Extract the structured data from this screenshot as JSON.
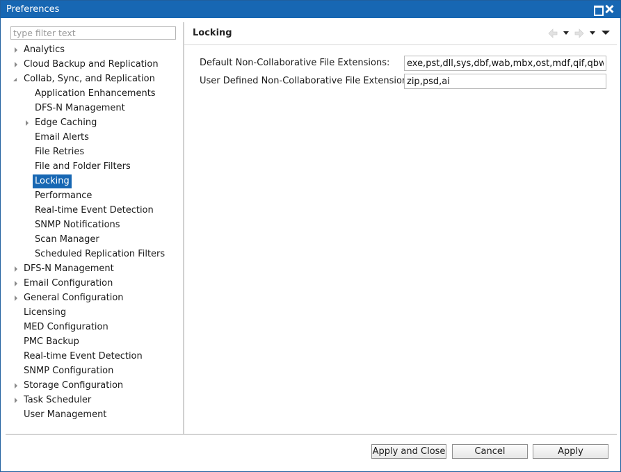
{
  "window": {
    "title": "Preferences"
  },
  "filter": {
    "placeholder": "type filter text",
    "value": ""
  },
  "tree": [
    {
      "label": "Analytics",
      "expander": "collapsed",
      "level": 0
    },
    {
      "label": "Cloud Backup and Replication",
      "expander": "collapsed",
      "level": 0
    },
    {
      "label": "Collab, Sync, and Replication",
      "expander": "expanded",
      "level": 0
    },
    {
      "label": "Application Enhancements",
      "expander": "none",
      "level": 1
    },
    {
      "label": "DFS-N Management",
      "expander": "none",
      "level": 1
    },
    {
      "label": "Edge Caching",
      "expander": "collapsed",
      "level": 1
    },
    {
      "label": "Email Alerts",
      "expander": "none",
      "level": 1
    },
    {
      "label": "File Retries",
      "expander": "none",
      "level": 1
    },
    {
      "label": "File and Folder Filters",
      "expander": "none",
      "level": 1
    },
    {
      "label": "Locking",
      "expander": "none",
      "level": 1,
      "selected": true
    },
    {
      "label": "Performance",
      "expander": "none",
      "level": 1
    },
    {
      "label": "Real-time Event Detection",
      "expander": "none",
      "level": 1
    },
    {
      "label": "SNMP Notifications",
      "expander": "none",
      "level": 1
    },
    {
      "label": "Scan Manager",
      "expander": "none",
      "level": 1
    },
    {
      "label": "Scheduled Replication Filters",
      "expander": "none",
      "level": 1
    },
    {
      "label": "DFS-N Management",
      "expander": "collapsed",
      "level": 0
    },
    {
      "label": "Email Configuration",
      "expander": "collapsed",
      "level": 0
    },
    {
      "label": "General Configuration",
      "expander": "collapsed",
      "level": 0
    },
    {
      "label": "Licensing",
      "expander": "none",
      "level": 0
    },
    {
      "label": "MED Configuration",
      "expander": "none",
      "level": 0
    },
    {
      "label": "PMC Backup",
      "expander": "none",
      "level": 0
    },
    {
      "label": "Real-time Event Detection",
      "expander": "none",
      "level": 0
    },
    {
      "label": "SNMP Configuration",
      "expander": "none",
      "level": 0
    },
    {
      "label": "Storage Configuration",
      "expander": "collapsed",
      "level": 0
    },
    {
      "label": "Task Scheduler",
      "expander": "collapsed",
      "level": 0
    },
    {
      "label": "User Management",
      "expander": "none",
      "level": 0
    }
  ],
  "page": {
    "title": "Locking",
    "fields": [
      {
        "label": "Default Non-Collaborative File Extensions:",
        "value": "exe,pst,dll,sys,dbf,wab,mbx,ost,mdf,qif,qbw"
      },
      {
        "label": "User Defined Non-Collaborative File Extensions:",
        "value": "zip,psd,ai"
      }
    ]
  },
  "buttons": {
    "apply_close": "Apply and Close",
    "cancel": "Cancel",
    "apply": "Apply"
  }
}
